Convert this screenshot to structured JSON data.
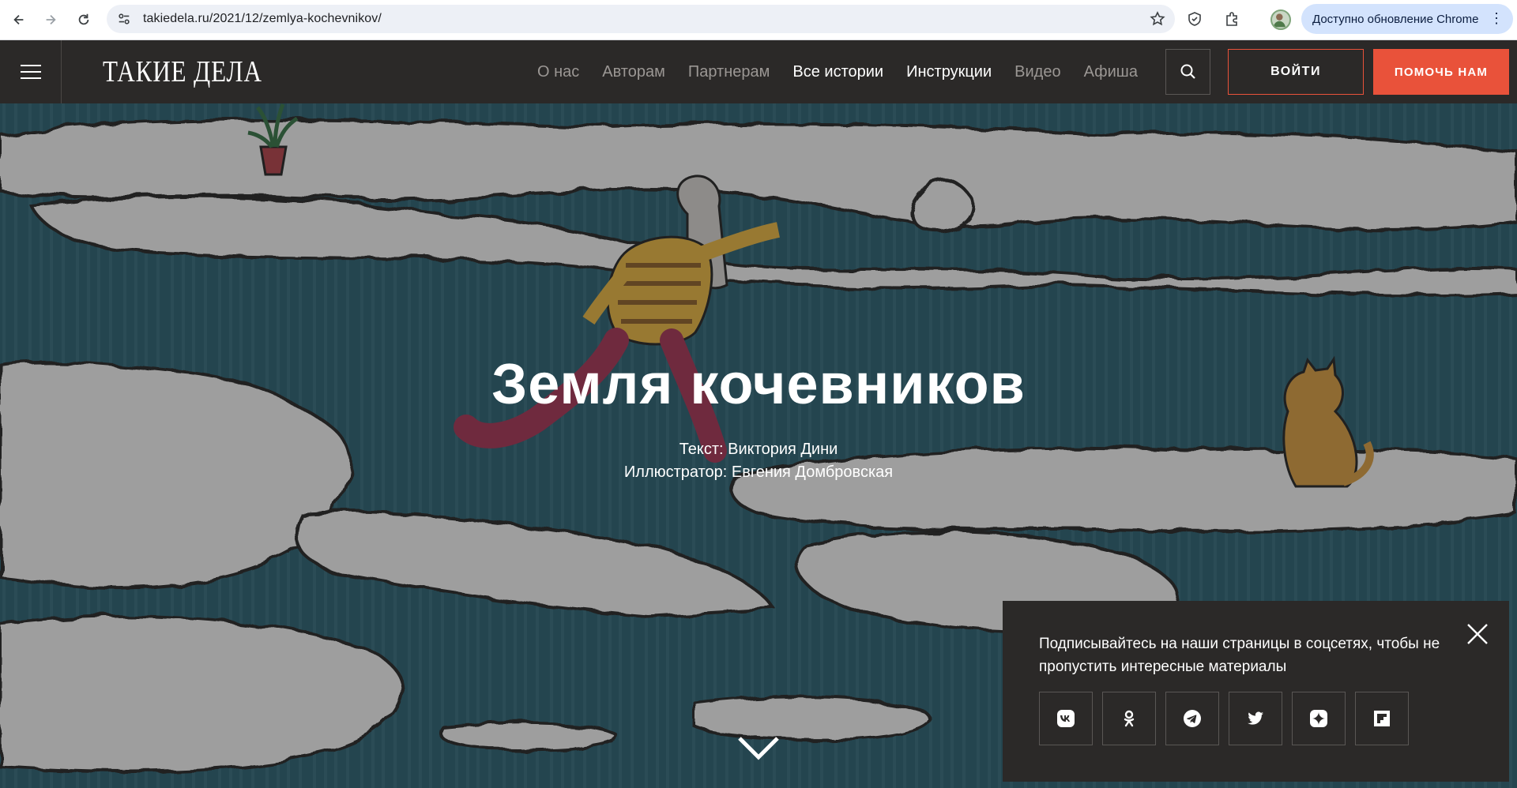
{
  "browser": {
    "url": "takiedela.ru/2021/12/zemlya-kochevnikov/",
    "update_label": "Доступно обновление Chrome"
  },
  "header": {
    "logo": "ТАКИЕ ДЕЛА",
    "nav": [
      {
        "label": "О нас"
      },
      {
        "label": "Авторам"
      },
      {
        "label": "Партнерам"
      },
      {
        "label": "Все истории"
      },
      {
        "label": "Инструкции"
      },
      {
        "label": "Видео"
      },
      {
        "label": "Афиша"
      }
    ],
    "login_label": "ВОЙТИ",
    "help_label": "ПОМОЧЬ НАМ",
    "accent_color": "#e9523a"
  },
  "hero": {
    "title": "Земля кочевников",
    "credit_text": "Текст: Виктория Дини",
    "credit_illustrator": "Иллюстратор: Евгения Домбровская"
  },
  "social_popup": {
    "message": "Подписывайтесь на наши страницы в соцсетях, чтобы не пропустить интересные материалы",
    "networks": [
      "vk-icon",
      "odnoklassniki-icon",
      "telegram-icon",
      "twitter-icon",
      "zen-icon",
      "flipboard-icon"
    ]
  }
}
